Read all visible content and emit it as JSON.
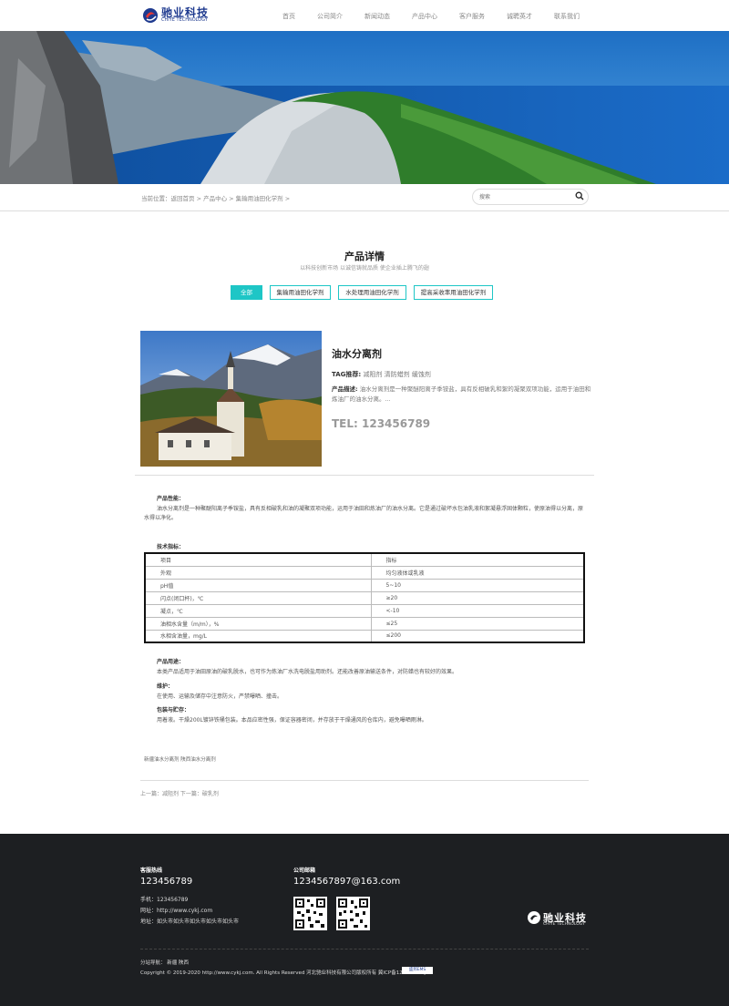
{
  "header": {
    "logo_text": "驰业科技",
    "logo_sub": "CHIYE TECHNOLOGY",
    "nav": [
      "首页",
      "公司简介",
      "新闻动态",
      "产品中心",
      "客户服务",
      "诚聘英才",
      "联系我们"
    ]
  },
  "breadcrumb": {
    "text": "当前位置：返回首页 > 产品中心 > 集输用油田化学剂 >"
  },
  "search": {
    "placeholder": "搜索"
  },
  "section": {
    "title": "产品详情",
    "subtitle": "以科技创新市场 以诚信铸就品质 使企业插上腾飞的翅",
    "tabs": [
      "全部",
      "集输用油田化学剂",
      "水处理用油田化学剂",
      "提高采收率用油田化学剂"
    ]
  },
  "product": {
    "name": "油水分离剂",
    "tags_label": "TAG推荐:",
    "tags": "减阻剂  清防蜡剂  缓蚀剂",
    "desc_label": "产品描述:",
    "desc": "油水分离剂是一种聚醚阳离子季铵盐，具有反相破乳和絮的凝聚双项功能，运用于油田和炼油厂的油水分离。...",
    "tel": "TEL: 123456789"
  },
  "detail": {
    "perf_title": "产品性能：",
    "perf_text": "油水分离剂是一种聚醚阳离子季铵盐，具有反相破乳和油的凝聚双项功能，运用于油田和炼油厂的油水分离。它是通过破坏水包油乳液和絮凝悬浮固体颗粒，使原油得以分离，原水得以净化。",
    "tech_title": "技术指标：",
    "table": [
      [
        "项目",
        "指标"
      ],
      [
        "外观",
        "均匀液体或乳液"
      ],
      [
        "pH值",
        "5~10"
      ],
      [
        "闪点(闭口杯)，℃",
        "≥20"
      ],
      [
        "凝点，℃",
        "<-10"
      ],
      [
        "油相水含量（m/m），%",
        "≤25"
      ],
      [
        "水相含油量，mg/L",
        "≤200"
      ]
    ],
    "use_title": "产品用途：",
    "use_text": "本类产品适用于油田原油的破乳脱水，也可作为炼油厂水洗电脱盐用助剂。还能改善原油输送条件，对防蜡也有较好的效果。",
    "maint_title": "维护：",
    "maint_text": "在使用、运输及储存中注意防火，严禁曝晒、撞击。",
    "pack_title": "包装与贮存：",
    "pack_text": "用着液。干燥200L镀锌铁桶包装。本品应密性强，保证容器密闭，并存放于干燥通风的仓库内，避免曝晒雨淋。"
  },
  "tag_links": "新疆油水分离剂   陕西油水分离剂",
  "prevnext": "上一篇：减阻剂        下一篇：破乳剂",
  "footer": {
    "hotline_title": "客服热线",
    "hotline": "123456789",
    "mobile": "手机：123456789",
    "website": "网址：http://www.cykj.com",
    "address": "地址：如头市如头市如头市如头市如头市",
    "email_title": "公司邮箱",
    "email": "123456789​7@163.com",
    "logo_text": "驰业科技",
    "logo_sub": "CHIYE TECHNOLOGY",
    "sitemap": "分站导航：  新疆    陕西",
    "copyright": "Copyright © 2019-2020 http://www.cykj.com. All Rights Reserved 河北驰业科技有限公司版权所有  冀ICP备12345678号-1",
    "badge": "盛邦EMS"
  },
  "colors": {
    "accent": "#1ec6c6",
    "brand": "#1e3a8f",
    "footer_bg": "#1d1f22"
  }
}
